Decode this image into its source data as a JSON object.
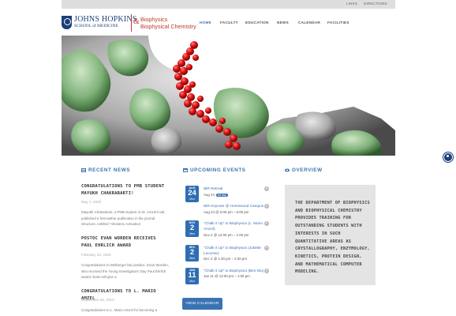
{
  "topbar": {
    "links": [
      "LINKS",
      "DIRECTIONS"
    ]
  },
  "brand": {
    "university": "JOHNS HOPKINS",
    "school": "SCHOOL of MEDICINE",
    "ampersand": "&",
    "dept_line1": "Biophysics",
    "dept_line2": "Biophysical Chemistry"
  },
  "nav": {
    "items": [
      "HOME",
      "FACULTY",
      "EDUCATION",
      "NEWS",
      "CALENDAR",
      "FACILITIES"
    ],
    "active": "HOME"
  },
  "news": {
    "title": "RECENT NEWS",
    "icon": "newspaper-icon",
    "items": [
      {
        "headline": "CONGRATULATIONS TO PMB STUDENT MAYUKH CHAKRABARTI!",
        "date": "May 1, 2020",
        "body": "Mayukh Chakrabarti, a PMB student in Dr. Amzel's lab, published a first-author publication in the journal Structure, entitled \"Allosteric Activation"
      },
      {
        "headline": "POSTOC EVAN WORDEN RECEIVES PAUL EHRLICH AWARD",
        "date": "February 18, 2020",
        "body": "Congratulations to Wolberger lab postdoc, Evan Worden, who received the Young Investigators' Day Paul Ehrlich award. Evan will give a"
      },
      {
        "headline": "CONGRATULATIONS TO L. MARIO AMZEL",
        "date": "September 20, 2019",
        "body": "Congratulations to L. Mario Amzel for becoming a"
      }
    ]
  },
  "events": {
    "title": "UPCOMING EVENTS",
    "icon": "calendar-icon",
    "items": [
      {
        "month": "AUG",
        "day": "24",
        "weekday": "Mon",
        "title": "IBR Retreat",
        "time": "Aug 24",
        "badge": "All day"
      },
      {
        "month": "",
        "day": "",
        "weekday": "",
        "title": "IBR Keynote @ Homewood Campus",
        "time": "Aug 24 @ 5:00 pm – 6:00 pm",
        "badge": ""
      },
      {
        "month": "NOV",
        "day": "2",
        "weekday": "Mon",
        "title": "\"Chalk it Up\" to Biophysics (L. Mario Amzel)",
        "time": "Nov 2 @ 12:00 pm – 1:00 pm",
        "badge": ""
      },
      {
        "month": "DEC",
        "day": "2",
        "weekday": "Wed",
        "title": "\"Chalk it Up\" to Biophysics (Juliette Lecomte)",
        "time": "Dec 2 @ 1:30 pm – 2:30 pm",
        "badge": ""
      },
      {
        "month": "JAN",
        "day": "11",
        "weekday": "Mon",
        "title": "\"Chalk it Up\" to Biophysics (Ben Wu)",
        "time": "Jan 11 @ 12:00 pm – 1:00 pm",
        "badge": ""
      }
    ],
    "view_label": "VIEW CALENDAR"
  },
  "overview": {
    "title": "OVERVIEW",
    "icon": "eye-icon",
    "text": "THE DEPARTMENT OF BIOPHYSICS AND BIOPHYSICAL CHEMISTRY PROVIDES TRAINING FOR OUTSTANDING STUDENTS WITH INTERESTS IN SUCH QUANTITATIVE AREAS AS CRYSTALLOGRAPHY, ENZYMOLOGY, KINETICS, PROTEIN DESIGN, AND MATHEMATICAL COMPUTER MODELING."
  },
  "colors": {
    "accent": "#3a73b3",
    "brand": "#1d3f7c",
    "dept_red": "#c0392b",
    "protein_green": "#7fb27a",
    "protein_red": "#dd1111"
  }
}
